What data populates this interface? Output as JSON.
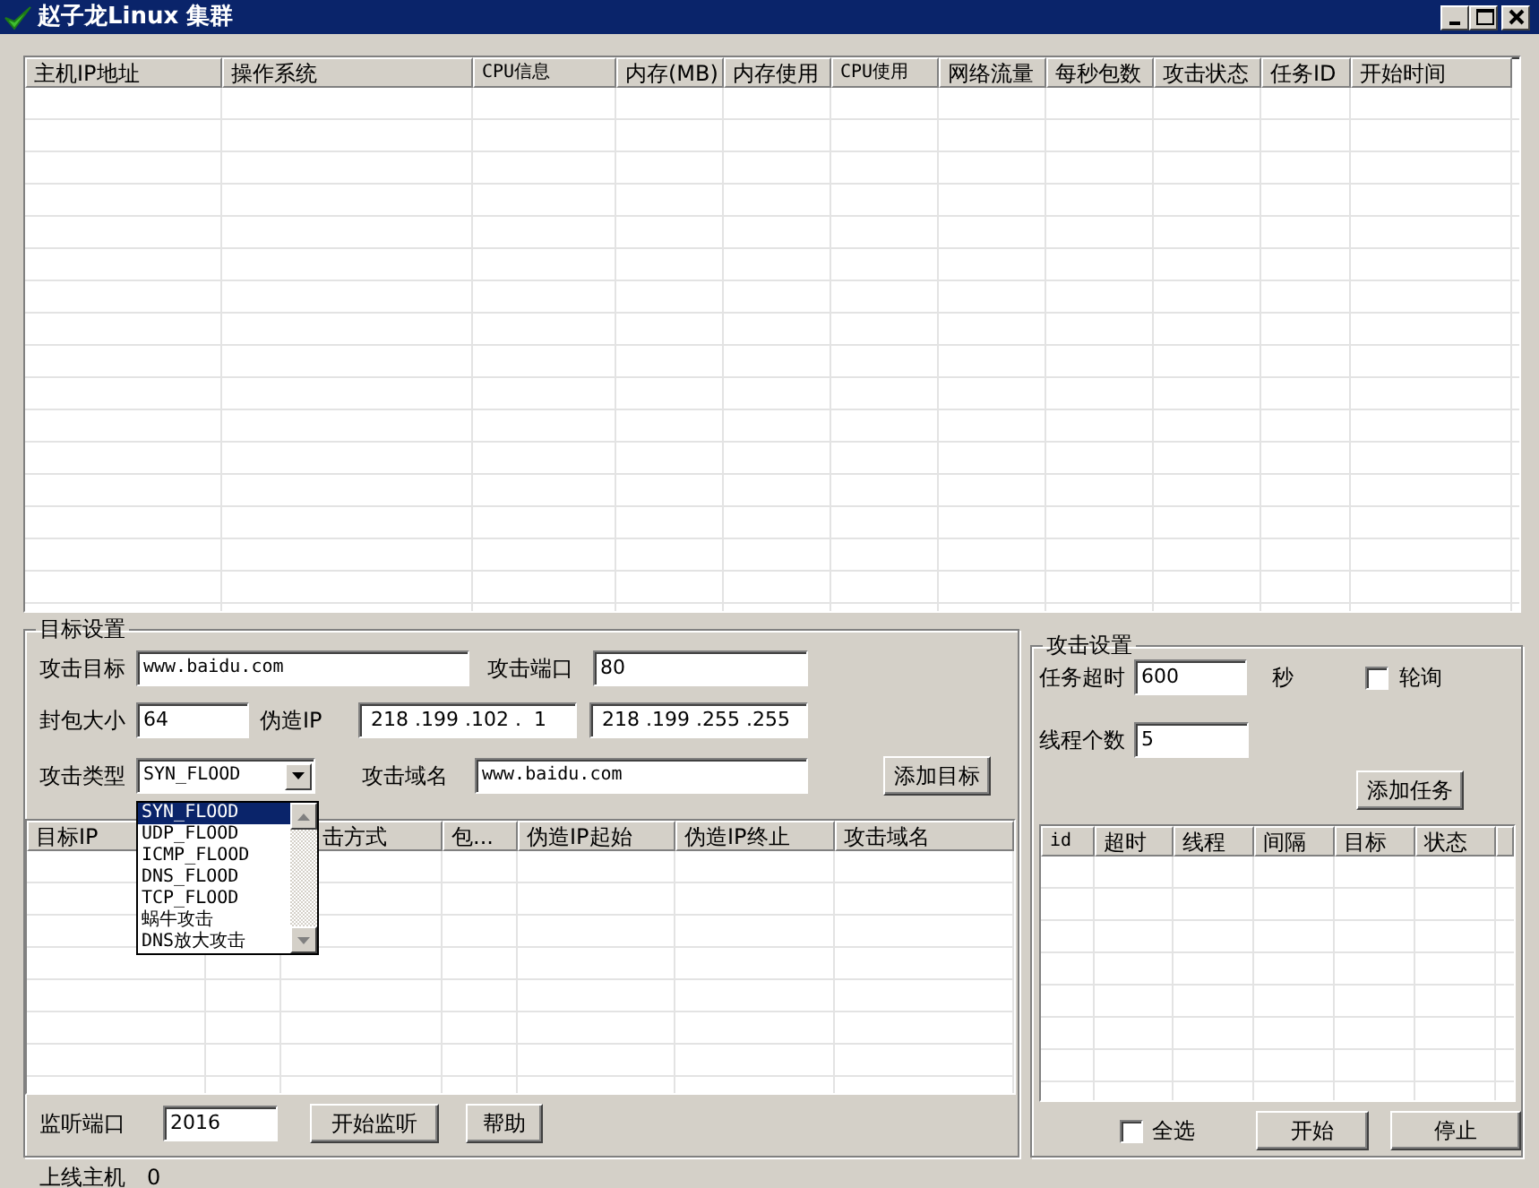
{
  "window": {
    "title": "赵子龙Linux 集群"
  },
  "hosts_table": {
    "columns": [
      "主机IP地址",
      "操作系统",
      "CPU信息",
      "内存(MB)",
      "内存使用",
      "CPU使用",
      "网络流量",
      "每秒包数",
      "攻击状态",
      "任务ID",
      "开始时间"
    ]
  },
  "target_settings": {
    "title": "目标设置",
    "attack_target": {
      "label": "攻击目标",
      "value": "www.baidu.com"
    },
    "attack_port": {
      "label": "攻击端口",
      "value": "80"
    },
    "packet_size": {
      "label": "封包大小",
      "value": "64"
    },
    "spoof_ip": {
      "label": "伪造IP",
      "start": "218 .199 .102 .  1",
      "end": "218 .199 .255 .255"
    },
    "attack_type": {
      "label": "攻击类型",
      "value": "SYN_FLOOD",
      "expanded": true,
      "options": [
        {
          "label": "SYN_FLOOD",
          "selected": true
        },
        {
          "label": "UDP_FLOOD",
          "selected": false
        },
        {
          "label": "ICMP_FLOOD",
          "selected": false
        },
        {
          "label": "DNS_FLOOD",
          "selected": false
        },
        {
          "label": "TCP_FLOOD",
          "selected": false
        },
        {
          "label": "蜗牛攻击",
          "selected": false
        },
        {
          "label": "DNS放大攻击",
          "selected": false
        }
      ]
    },
    "attack_domain": {
      "label": "攻击域名",
      "value": "www.baidu.com"
    },
    "add_target_button": "添加目标",
    "targets_table": {
      "columns": [
        {
          "label": "目标IP"
        },
        {},
        {
          "label": "击方式"
        },
        {
          "label": "包..."
        },
        {
          "label": "伪造IP起始"
        },
        {
          "label": "伪造IP终止"
        },
        {
          "label": "攻击域名"
        }
      ]
    },
    "listen_port": {
      "label": "监听端口",
      "value": "2016"
    },
    "start_listen_button": "开始监听",
    "help_button": "帮助"
  },
  "attack_settings": {
    "title": "攻击设置",
    "task_timeout": {
      "label": "任务超时",
      "value": "600",
      "unit": "秒"
    },
    "polling": {
      "label": "轮询",
      "checked": false
    },
    "thread_count": {
      "label": "线程个数",
      "value": "5"
    },
    "add_task_button": "添加任务",
    "tasks_table": {
      "columns": [
        "id",
        "超时",
        "线程",
        "间隔",
        "目标",
        "状态"
      ]
    },
    "select_all": {
      "label": "全选",
      "checked": false
    },
    "start_button": "开始",
    "stop_button": "停止"
  },
  "status_bar": {
    "label": "上线主机",
    "value": "0"
  }
}
